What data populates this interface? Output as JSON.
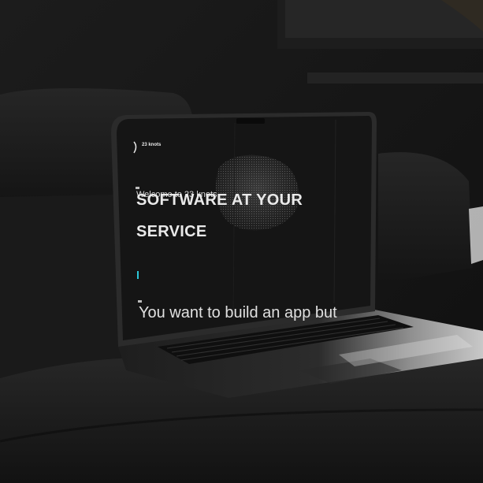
{
  "screen": {
    "logo_text": "23 knots",
    "welcome_text": "Welcome to 23 knots",
    "headline_line1": "SOFTWARE AT YOUR",
    "headline_line2": "SERVICE",
    "body_text": "You want to build an app but"
  },
  "colors": {
    "background": "#161616",
    "screen_bg": "#151515",
    "accent": "#2bc7d8",
    "text": "#e9e9e9"
  }
}
